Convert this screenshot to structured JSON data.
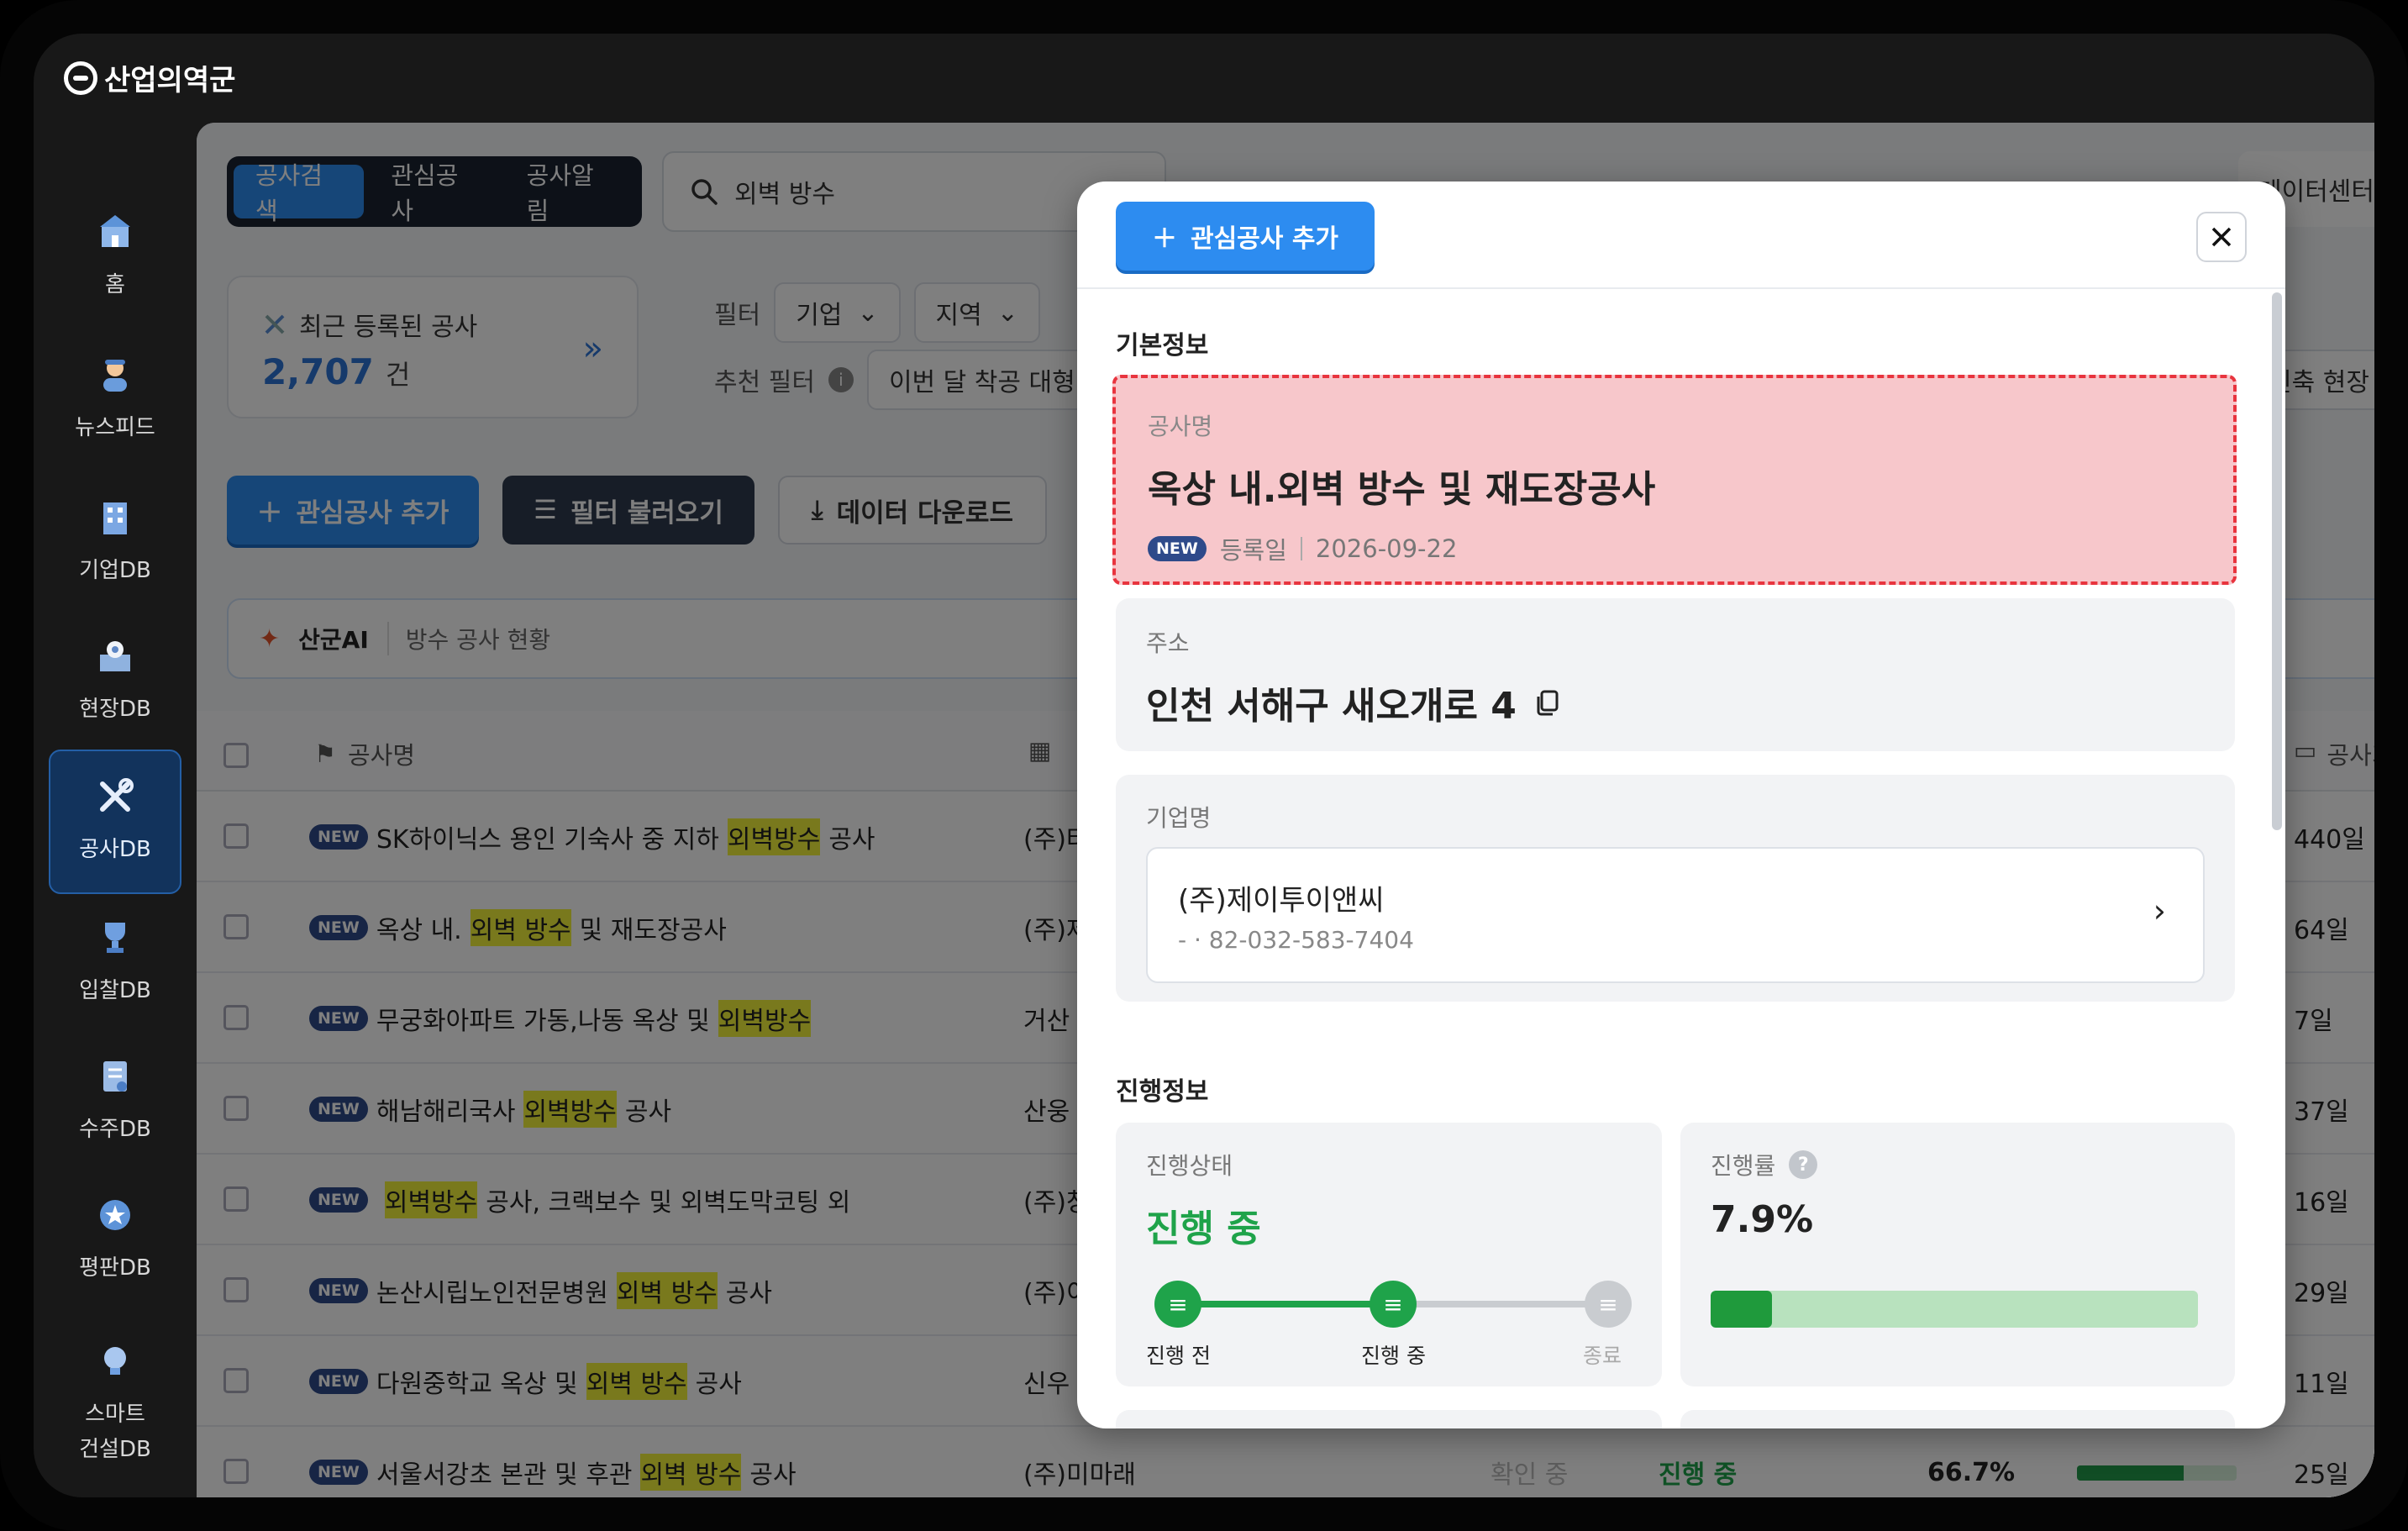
{
  "app": {
    "logo_text": "산업의역군"
  },
  "sidebar": {
    "items": [
      {
        "label": "홈"
      },
      {
        "label": "뉴스피드"
      },
      {
        "label": "기업DB"
      },
      {
        "label": "현장DB"
      },
      {
        "label": "공사DB"
      },
      {
        "label": "입찰DB"
      },
      {
        "label": "수주DB"
      },
      {
        "label": "평판DB"
      },
      {
        "label": "스마트\n건설DB"
      }
    ]
  },
  "top": {
    "tabs": [
      "공사검색",
      "관심공사",
      "공사알림"
    ],
    "search_value": "외벽 방수",
    "right_pill": "데이터센터"
  },
  "recent": {
    "label": "최근 등록된 공사",
    "count": "2,707",
    "unit": "건"
  },
  "filters": {
    "label": "필터",
    "chips": [
      "기업",
      "지역"
    ],
    "recommend_label": "추천 필터",
    "recommend_chip": "이번 달 착공 대형",
    "recommend_chip_right": "신축 현장"
  },
  "actions": {
    "add_interest": "관심공사 추가",
    "load_filter": "필터 불러오기",
    "download": "데이터 다운로드"
  },
  "ai": {
    "name": "산군AI",
    "desc": "방수 공사 현황"
  },
  "table": {
    "header_name": "공사명",
    "header_days": "공사기",
    "new_badge": "NEW",
    "rows": [
      {
        "pre": "SK하이닉스 용인 기숙사 중 지하",
        "hl": "외벽방수",
        "post": "공사",
        "company": "(주)타",
        "days": "440일"
      },
      {
        "pre": "옥상 내.",
        "hl": "외벽 방수",
        "post": "및 재도장공사",
        "company": "(주)제",
        "days": "64일"
      },
      {
        "pre": "무궁화아파트 가동,나동 옥상 및 ",
        "hl": "외벽방수",
        "post": "",
        "company": "거산",
        "days": "7일"
      },
      {
        "pre": "해남해리국사 ",
        "hl": "외벽방수",
        "post": "공사",
        "company": "산웅",
        "days": "37일"
      },
      {
        "pre": "",
        "hl": "외벽방수",
        "post": "공사, 크랙보수 및 외벽도막코팅 외",
        "company": "(주)창",
        "days": "16일"
      },
      {
        "pre": "논산시립노인전문병원 ",
        "hl": "외벽 방수",
        "post": "공사",
        "company": "(주)이",
        "days": "29일"
      },
      {
        "pre": "다원중학교 옥상 및 ",
        "hl": "외벽 방수",
        "post": "공사",
        "company": "신우",
        "days": "11일"
      },
      {
        "pre": "서울서강초 본관 및 후관 ",
        "hl": "외벽 방수",
        "post": "공사",
        "company": "(주)미마래",
        "days": "25일",
        "status": "확인 중",
        "stage": "진행 중",
        "pct": "66.7%",
        "pct_value": 0.667
      }
    ]
  },
  "modal": {
    "add_button": "관심공사 추가",
    "basic_section": "기본정보",
    "name_caption": "공사명",
    "name_value": "옥상 내.외벽 방수 및 재도장공사",
    "new_badge": "NEW",
    "reg_label": "등록일",
    "reg_date": "2026-09-22",
    "addr_caption": "주소",
    "addr_value": "인천 서해구 새오개로 4",
    "company_caption": "기업명",
    "company_name": "(주)제이투이앤씨",
    "company_phone": "- · 82-032-583-7404",
    "progress_section": "진행정보",
    "status_caption": "진행상태",
    "status_value": "진행 중",
    "steps": [
      "진행 전",
      "진행 중",
      "종료"
    ],
    "rate_caption": "진행률",
    "rate_value": "7.9%",
    "rate_fraction": 0.079
  },
  "colors": {
    "accent": "#2d8cf0",
    "progress_green": "#1fa34a",
    "highlight_red": "#e8343e"
  }
}
